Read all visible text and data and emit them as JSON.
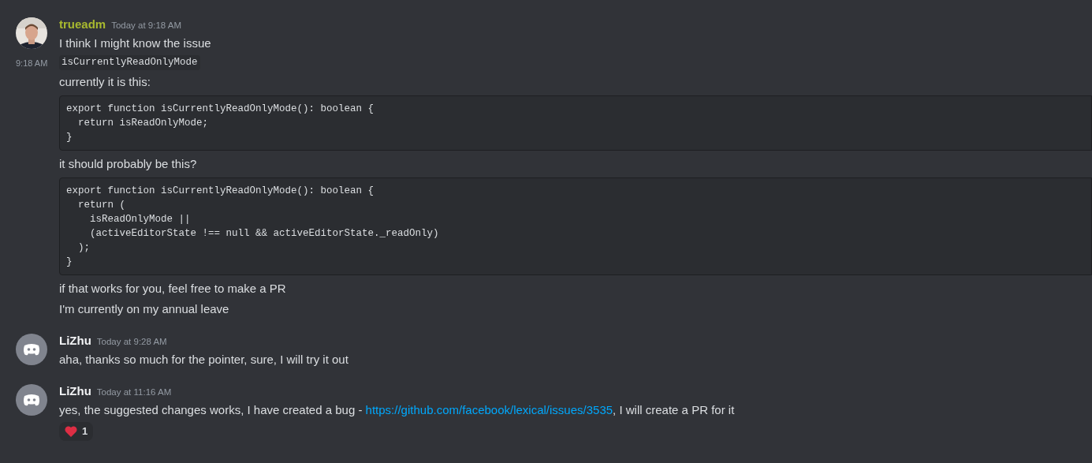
{
  "messages": [
    {
      "author": "trueadm",
      "color": "#a8b92f",
      "timestamp": "Today at 9:18 AM",
      "lines": [
        {
          "kind": "text",
          "text": "I think I might know the issue"
        },
        {
          "kind": "inline_code",
          "text": "isCurrentlyReadOnlyMode",
          "hover_time": "9:18 AM"
        },
        {
          "kind": "text",
          "text": "currently it is this:"
        },
        {
          "kind": "code_block",
          "code": [
            "export function isCurrentlyReadOnlyMode(): boolean {",
            "  return isReadOnlyMode;",
            "}"
          ]
        },
        {
          "kind": "text",
          "text": "it should probably be this?"
        },
        {
          "kind": "code_block",
          "code": [
            "export function isCurrentlyReadOnlyMode(): boolean {",
            "  return (",
            "    isReadOnlyMode ||",
            "    (activeEditorState !== null && activeEditorState._readOnly)",
            "  );",
            "}"
          ]
        },
        {
          "kind": "text",
          "text": "if that works for you, feel free to make a PR"
        },
        {
          "kind": "text",
          "text": "I'm currently on my annual leave"
        }
      ]
    },
    {
      "author": "LiZhu",
      "color": "#f2f3f5",
      "avatar": {
        "kind": "default"
      },
      "timestamp": "Today at 9:28 AM",
      "lines": [
        {
          "kind": "text",
          "text": "aha, thanks so much for the pointer, sure, I will try it out"
        }
      ]
    },
    {
      "author": "LiZhu",
      "color": "#f2f3f5",
      "avatar": {
        "kind": "default"
      },
      "timestamp": "Today at 11:16 AM",
      "lines": [
        {
          "kind": "rich_text",
          "parts": [
            {
              "kind": "text",
              "text": "yes, the suggested changes works, I have created a bug - "
            },
            {
              "kind": "link",
              "text": "https://github.com/facebook/lexical/issues/3535"
            },
            {
              "kind": "text",
              "text": ", I will create a PR for it"
            }
          ]
        }
      ],
      "reactions": [
        {
          "count": "1"
        }
      ]
    }
  ]
}
